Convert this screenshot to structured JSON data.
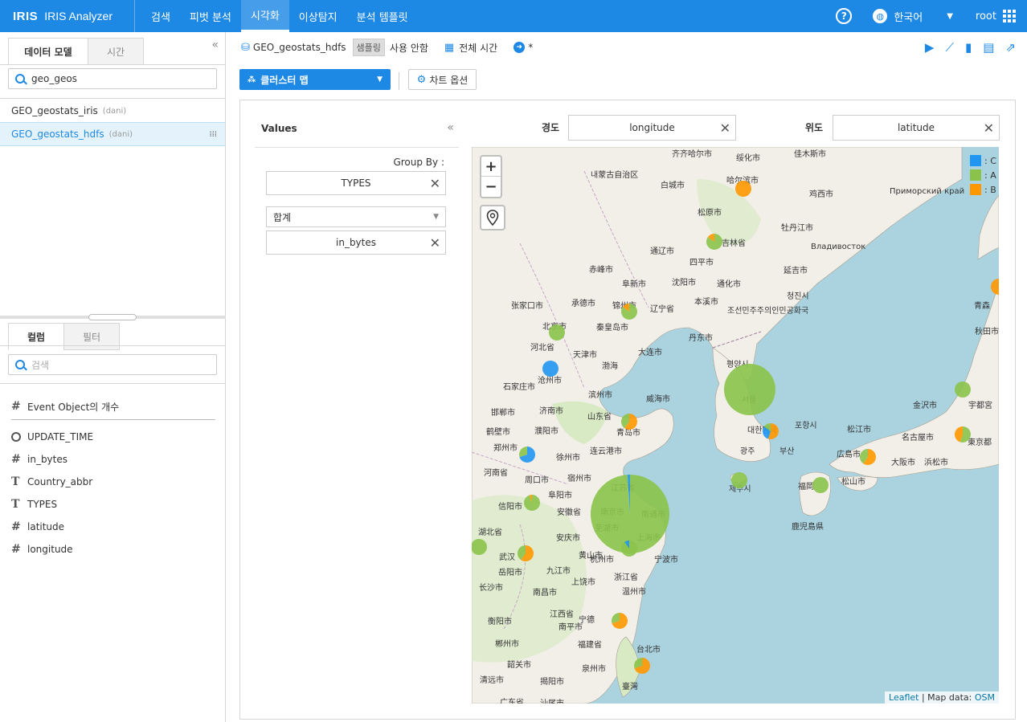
{
  "app": {
    "logo": "IRIS",
    "name": "IRIS Analyzer",
    "nav": [
      "검색",
      "피벗 분석",
      "시각화",
      "이상탐지",
      "분석 템플릿"
    ],
    "active_nav": "시각화",
    "language": "한국어",
    "user": "root"
  },
  "left": {
    "tabs": [
      "데이터 모델",
      "시간"
    ],
    "search_value": "geo_geos",
    "models": [
      {
        "name": "GEO_geostats_iris",
        "owner": "(dani)",
        "selected": false
      },
      {
        "name": "GEO_geostats_hdfs",
        "owner": "(dani)",
        "selected": true
      }
    ],
    "field_tabs": [
      "컬럼",
      "필터"
    ],
    "field_search_placeholder": "검색",
    "fields": [
      {
        "type": "number",
        "name": "Event Object의 개수"
      },
      {
        "type": "time",
        "name": "UPDATE_TIME"
      },
      {
        "type": "number",
        "name": "in_bytes"
      },
      {
        "type": "text",
        "name": "Country_abbr"
      },
      {
        "type": "text",
        "name": "TYPES"
      },
      {
        "type": "number",
        "name": "latitude"
      },
      {
        "type": "number",
        "name": "longitude"
      }
    ]
  },
  "toolbar": {
    "dataset": "GEO_geostats_hdfs",
    "sampling_badge": "샘플링",
    "sampling_state": "사용 안함",
    "time_range": "전체 시간",
    "star": "*"
  },
  "chart": {
    "type_label": "클러스터 맵",
    "options_label": "차트 옵션",
    "values_title": "Values",
    "group_by_label": "Group By :",
    "group_by_value": "TYPES",
    "aggregate": "합계",
    "value_field": "in_bytes",
    "lon_label": "경도",
    "lon_value": "longitude",
    "lat_label": "위도",
    "lat_value": "latitude"
  },
  "map": {
    "zoom_in": "+",
    "zoom_out": "−",
    "legend": [
      {
        "label": ": C",
        "color": "#2196f3"
      },
      {
        "label": ": A",
        "color": "#8bc34a"
      },
      {
        "label": ": B",
        "color": "#ff9800"
      }
    ],
    "attribution_link1": "Leaflet",
    "attribution_text": " | Map data: ",
    "attribution_link2": "OSM",
    "labels": [
      "내蒙古自治区",
      "齐齐哈尔市",
      "绥化市",
      "佳木斯市",
      "哈尔滨市",
      "白城市",
      "鸡西市",
      "Приморский край",
      "松原市",
      "吉林省",
      "牡丹江市",
      "通辽市",
      "四平市",
      "Владивосток",
      "赤峰市",
      "阜新市",
      "沈阳市",
      "通化市",
      "延吉市",
      "张家口市",
      "承德市",
      "锦州市",
      "辽宁省",
      "本溪市",
      "조선민주주의인민공화국",
      "청진시",
      "北京市",
      "秦皇岛市",
      "丹东市",
      "河北省",
      "天津市",
      "大连市",
      "평양시",
      "渤海",
      "沧州市",
      "石家庄市",
      "滨州市",
      "威海市",
      "서울",
      "山东省",
      "邯郸市",
      "济南市",
      "青岛市",
      "대한민국",
      "포항시",
      "鹤壁市",
      "濮阳市",
      "광주",
      "부산",
      "郑州市",
      "连云港市",
      "徐州市",
      "제주시",
      "宿州市",
      "河南省",
      "周口市",
      "阜阳市",
      "江苏省",
      "信阳市",
      "安徽省",
      "南京市",
      "南通市",
      "芜湖市",
      "上海市",
      "湖北省",
      "安庆市",
      "黄山市",
      "杭州市",
      "宁波市",
      "武汉",
      "岳阳市",
      "九江市",
      "浙江省",
      "长沙市",
      "上饶市",
      "南昌市",
      "温州市",
      "江西省",
      "衡阳市",
      "南平市",
      "宁德",
      "福建省",
      "郴州市",
      "台北市",
      "韶关市",
      "泉州市",
      "臺灣",
      "清远市",
      "揭阳市",
      "广东省",
      "汕尾市",
      "松江市",
      "金沢市",
      "宇都宮",
      "名古屋市",
      "東京都",
      "広島市",
      "大阪市",
      "浜松市",
      "福岡",
      "松山市",
      "鹿児島県",
      "秋田市",
      "青森"
    ]
  }
}
